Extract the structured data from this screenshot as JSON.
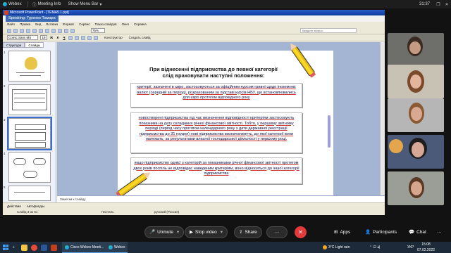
{
  "webex": {
    "app_name": "Webex",
    "meeting_info": "Meeting Info",
    "show_menu_bar": "Show Menu Bar",
    "time": "31:37",
    "restore_icon": "restore-icon",
    "close_icon": "close-icon"
  },
  "ppt": {
    "window_title": "Microsoft PowerPoint - [ТЕМА5.1.ppt]",
    "speaking": "Speaking: Гуренко Тамара",
    "menu": [
      "Файл",
      "Правка",
      "Вид",
      "Вставка",
      "Формат",
      "Сервис",
      "Показ слайдов",
      "Окно",
      "Справка"
    ],
    "zoom": "75%",
    "help_hint": "Введите вопрос",
    "font": "Comic Sans MS",
    "font_size": "18",
    "bold": "Ж",
    "italic": "К",
    "underline": "Ч",
    "constructor": "Конструктор",
    "new_slide": "Создать слайд",
    "tabs": [
      "Структура",
      "Слайды"
    ],
    "thumb_numbers": [
      "1",
      "2",
      "3",
      "4",
      "5"
    ],
    "notes_placeholder": "Заметки к слайду",
    "draw_bar": [
      "Действия",
      "Автофигуры"
    ],
    "status": {
      "slide": "Слайд 3 из 61",
      "design": "Пастиль",
      "language": "русский (Россия)"
    }
  },
  "slide": {
    "title_line1": "При віднесенні підприємства до певної категорії",
    "title_line2": "слід враховувати наступні положення:",
    "box1": "критерії, зазначені в євро, застосовуються за офіційним курсом гривні щодо іноземних валют (середній за період), розрахованим за підставі курсів НБУ, що встановлювались для євро протягом відповідного року",
    "box2": "новостворені підприємства під час визначення відповідності критеріям застосовують показники на дату складання річної фінансової звітності. Тобто, у першому звітному періоді (період часу протягом календарного року з дати державної реєстрації підприємства до 31 грудня) нові підприємства визначатимуть, до якої категорії вони належать, за результатами власної господарської діяльності у першому році.",
    "box3": "якщо підприємство однієї з категорій за показниками річної фінансової звітності протягом двох років поспіль не відповідає наведеним критеріям, воно відноситься до іншої категорії підприємства"
  },
  "controls": {
    "unmute": "Unmute",
    "stop_video": "Stop video",
    "share": "Share",
    "apps": "Apps",
    "participants": "Participants",
    "chat": "Chat"
  },
  "taskbar": {
    "cisco": "Cisco Webex Meeti...",
    "webex": "Webex",
    "weather": "3°C  Light rain",
    "lang": "УКР",
    "clock": "15:08",
    "date": "07.02.2022"
  }
}
